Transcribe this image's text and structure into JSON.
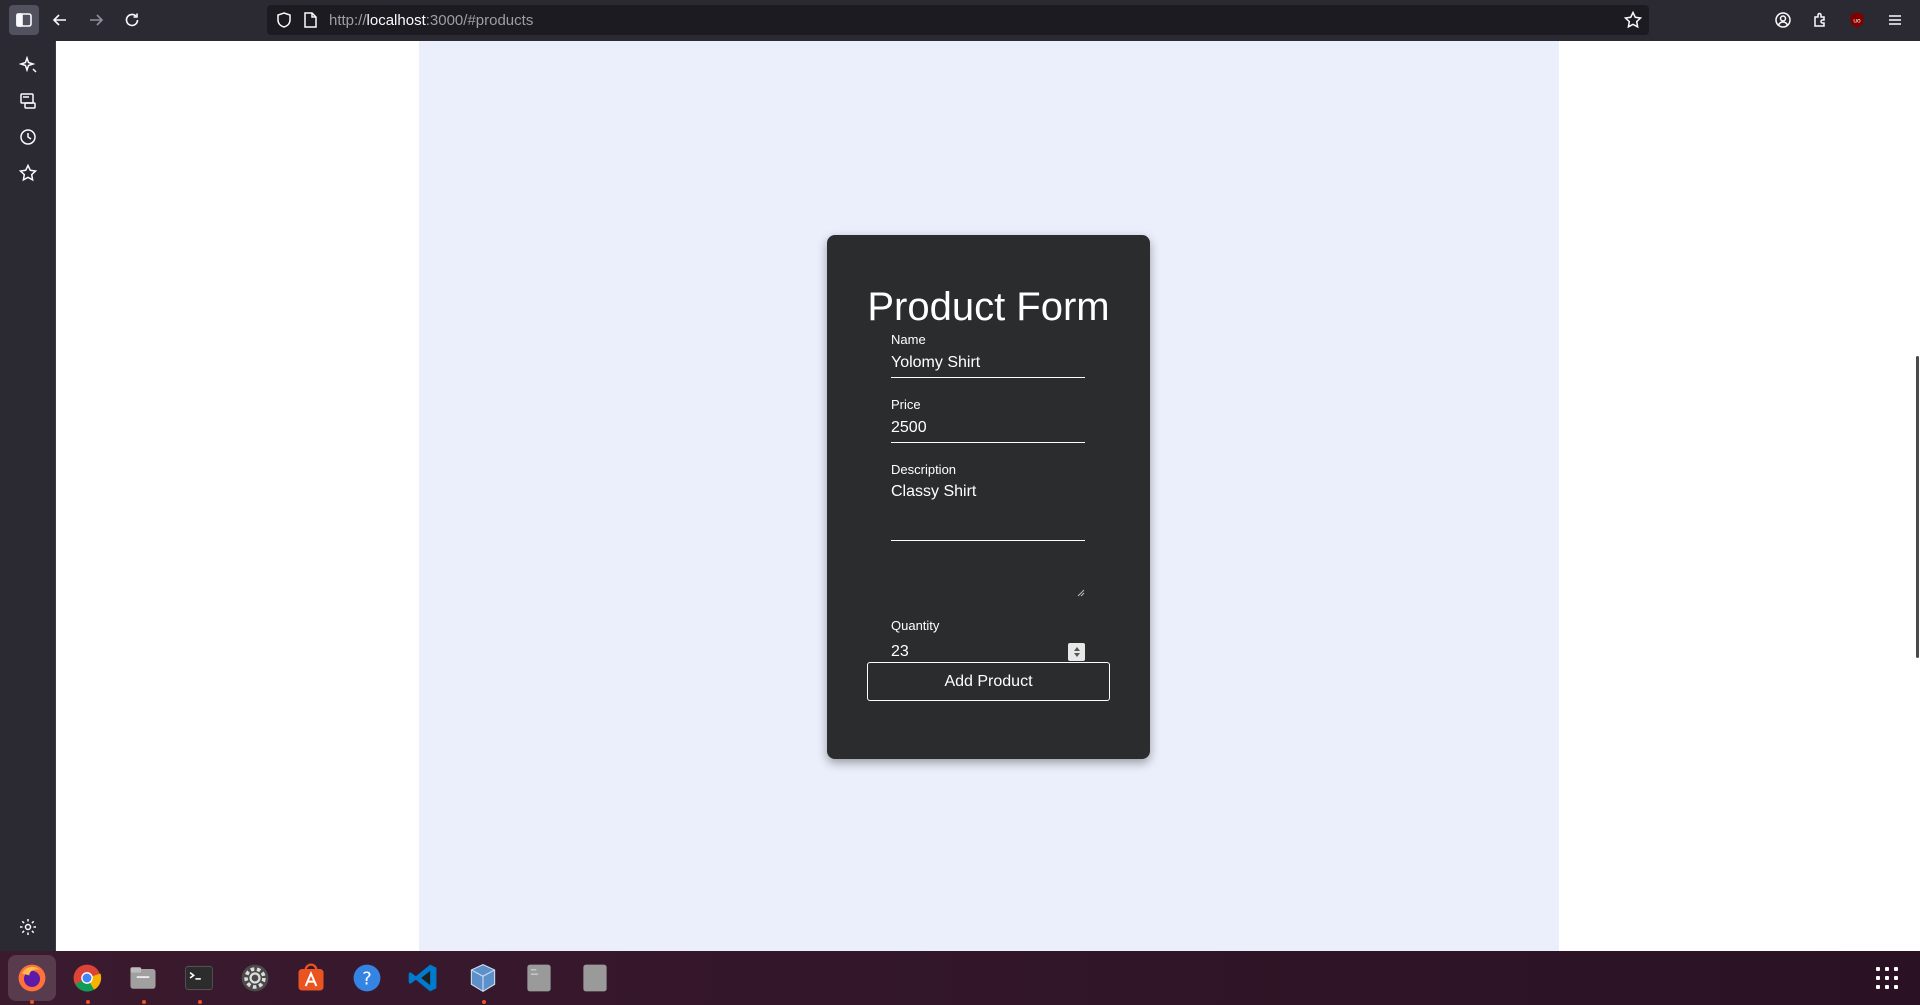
{
  "browser": {
    "url_scheme": "http://",
    "url_host": "localhost",
    "url_rest": ":3000/#products"
  },
  "form": {
    "title": "Product Form",
    "name_label": "Name",
    "name_value": "Yolomy Shirt",
    "price_label": "Price",
    "price_value": "2500",
    "description_label": "Description",
    "description_value": "Classy Shirt",
    "quantity_label": "Quantity",
    "quantity_value": "23",
    "submit_label": "Add Product"
  },
  "colors": {
    "card_bg": "#2b2c2e",
    "page_bg": "#ebeffb",
    "toolbar_bg": "#2b2a33"
  },
  "taskbar": {
    "apps": [
      "firefox-icon",
      "chrome-icon",
      "files-icon",
      "terminal-icon",
      "settings-icon",
      "app-center-icon",
      "help-icon",
      "vscode-icon",
      "virtualbox-icon",
      "drive-icon",
      "ssd-icon"
    ]
  }
}
